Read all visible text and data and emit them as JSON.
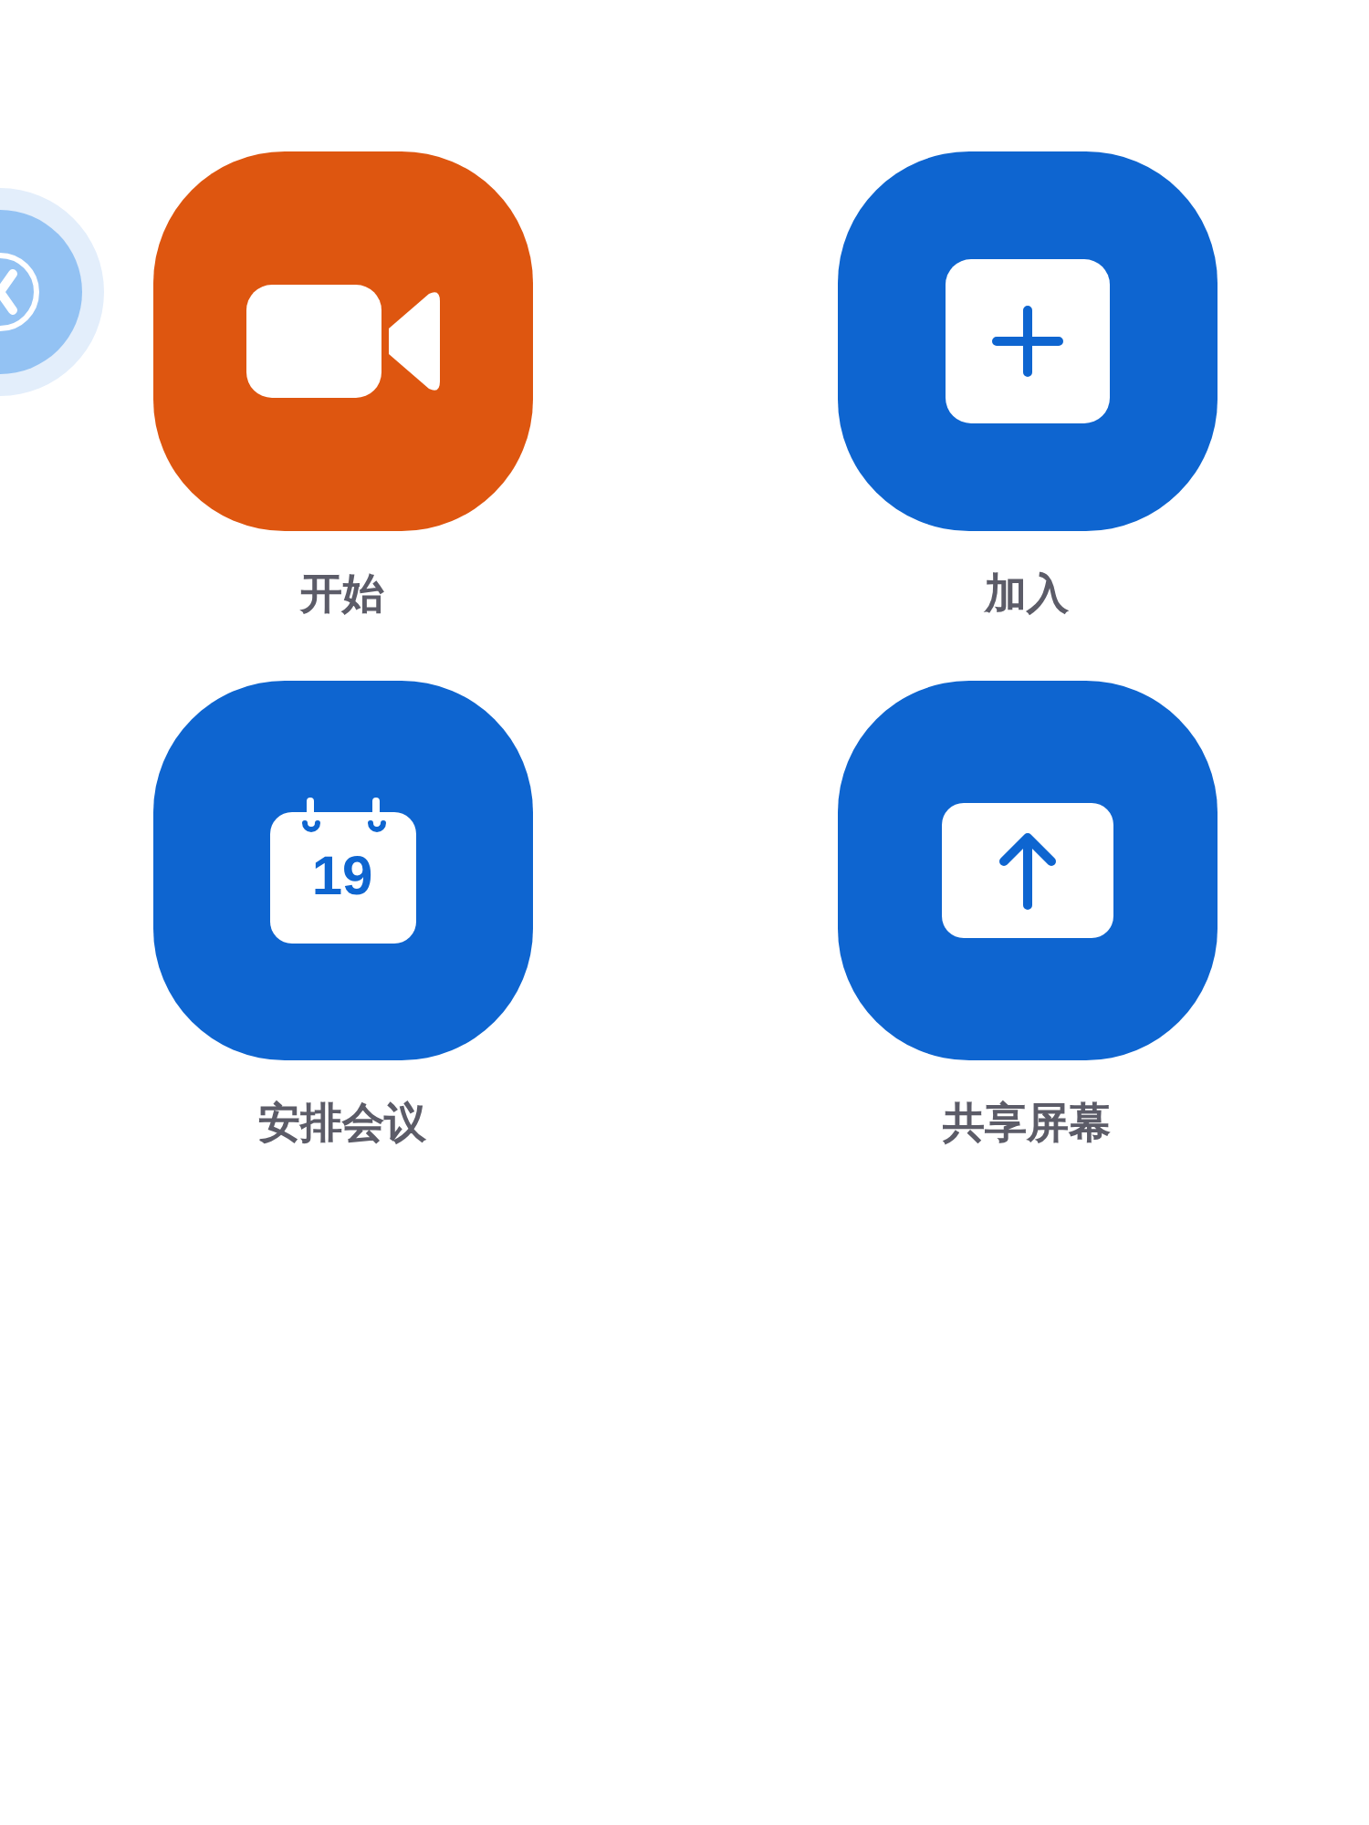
{
  "actions": [
    {
      "kind": "video",
      "label": "开始",
      "color": "#de5610"
    },
    {
      "kind": "join",
      "label": "加入",
      "color": "#0e65d0"
    },
    {
      "kind": "calendar",
      "label": "安排会议",
      "date": "19",
      "color": "#0e65d0"
    },
    {
      "kind": "share",
      "label": "共享屏幕",
      "color": "#0e65d0"
    }
  ]
}
